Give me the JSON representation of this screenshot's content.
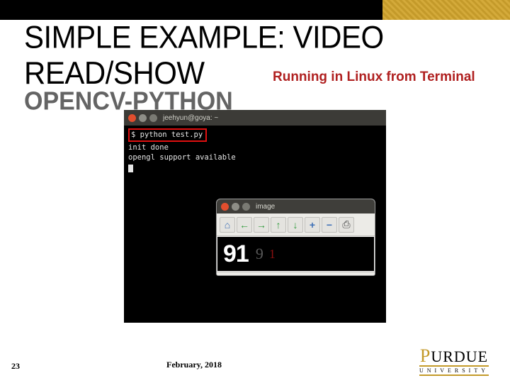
{
  "header": {
    "title": "SIMPLE EXAMPLE: VIDEO READ/SHOW",
    "subtitle": "OPENCV-PYTHON",
    "running_note": "Running in Linux from Terminal"
  },
  "terminal": {
    "titlebar_label": "jeehyun@goya: ~",
    "prompt": "$ ",
    "cmd": "python test.py",
    "line1": "init done",
    "line2": "opengl support available"
  },
  "image_window": {
    "title": "image",
    "toolbar": {
      "home": "⌂",
      "back": "←",
      "fwd": "→",
      "up": "↑",
      "down": "↓",
      "zoom_in": "+",
      "zoom_out": "−",
      "save": "⎙"
    },
    "content": {
      "big": "91",
      "mid": "9",
      "small": "1"
    }
  },
  "footer": {
    "page_num": "23",
    "date": "February, 2018",
    "logo_main": "PURDUE",
    "logo_sub": "UNIVERSITY"
  }
}
